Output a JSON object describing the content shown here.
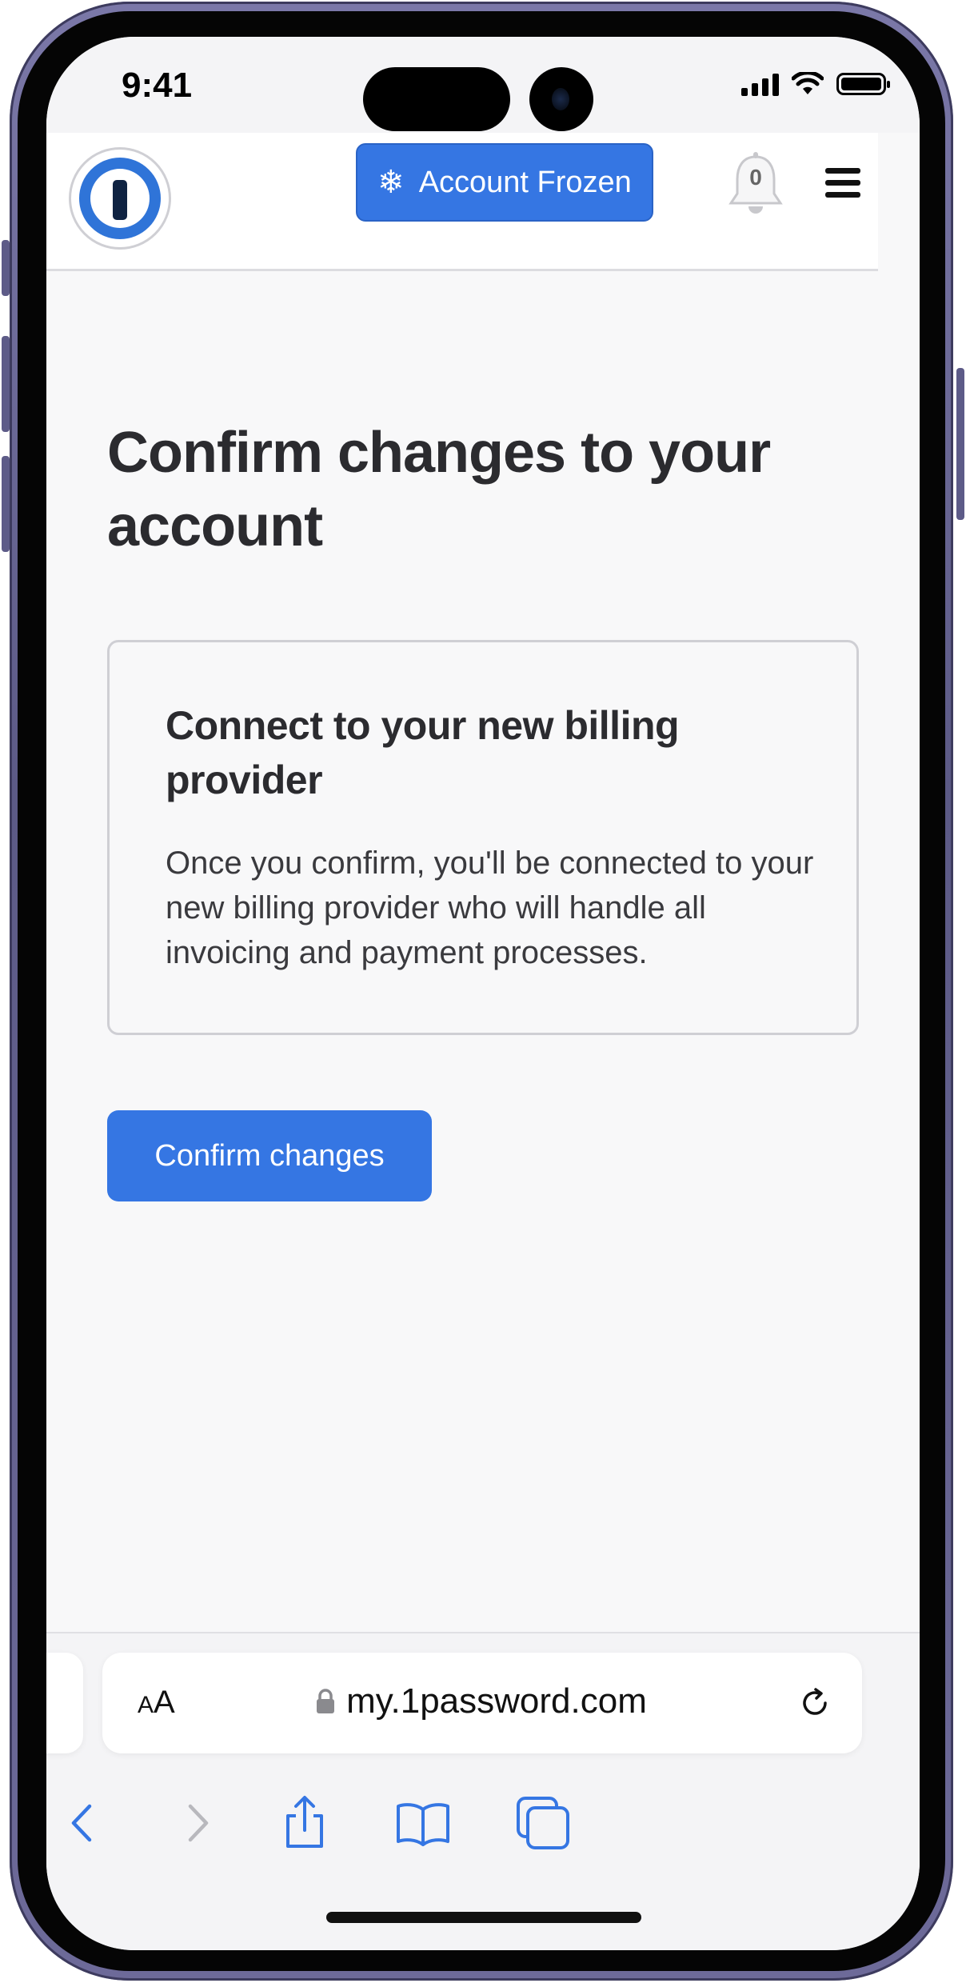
{
  "status_bar": {
    "time": "9:41"
  },
  "header": {
    "account_button_label": "Account Frozen",
    "account_button_icon": "snowflake-icon",
    "notification_count": "0"
  },
  "main": {
    "title": "Confirm changes to your account",
    "card": {
      "title": "Connect to your new billing provider",
      "body": "Once you confirm, you'll be connected to your new billing provider who will handle all invoicing and payment processes."
    },
    "confirm_button_label": "Confirm changes"
  },
  "browser": {
    "text_size_label_large": "A",
    "text_size_label_small": "A",
    "url": "my.1password.com"
  },
  "colors": {
    "accent": "#3576e3",
    "text": "#2b2b2f",
    "background": "#f8f8f9"
  }
}
